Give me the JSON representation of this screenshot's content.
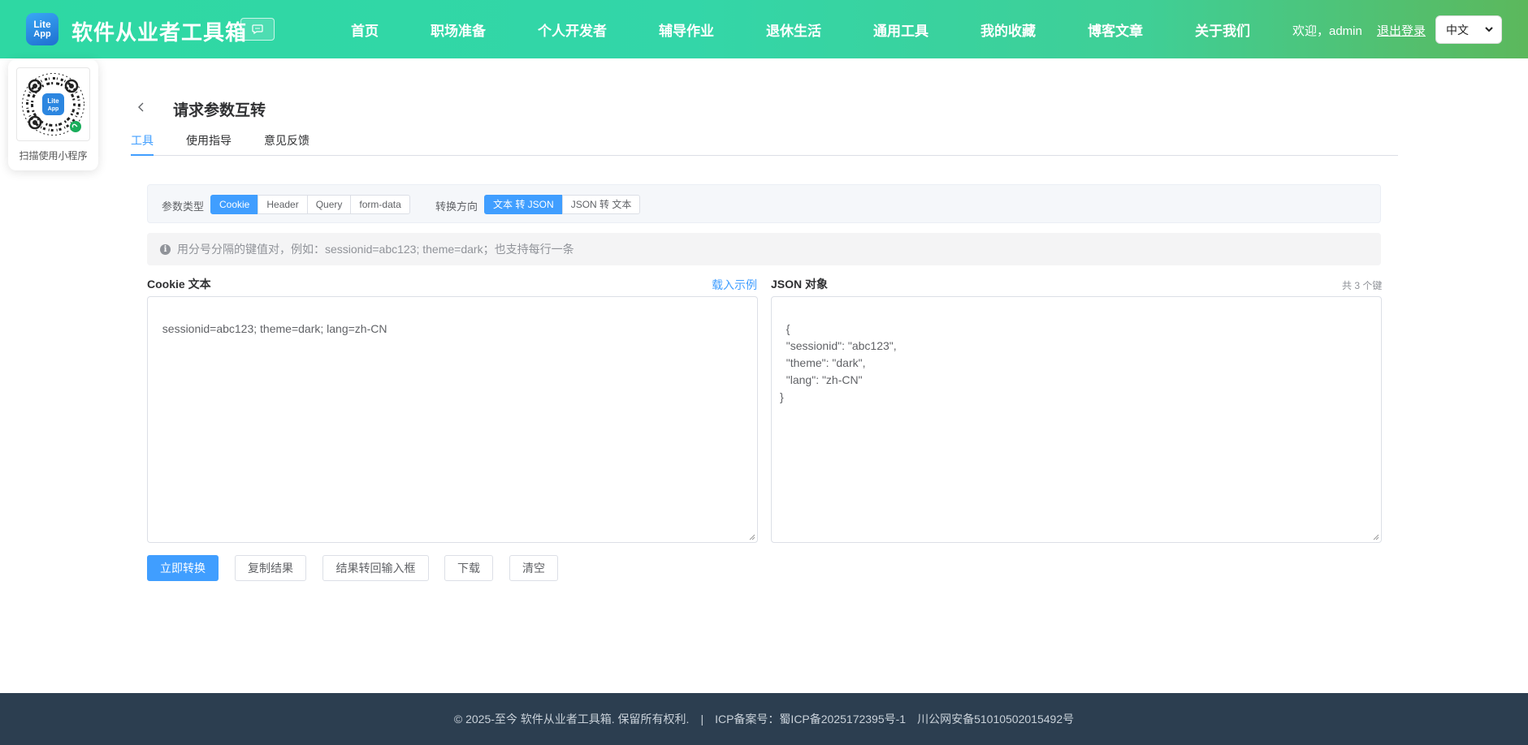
{
  "header": {
    "logo_line1": "Lite",
    "logo_line2": "App",
    "site_title": "软件从业者工具箱",
    "nav": [
      "首页",
      "职场准备",
      "个人开发者",
      "辅导作业",
      "退休生活",
      "通用工具",
      "我的收藏",
      "博客文章",
      "关于我们"
    ],
    "welcome": "欢迎，admin",
    "logout": "退出登录",
    "language": "中文"
  },
  "qr_card": {
    "label": "扫描使用小程序"
  },
  "page": {
    "title": "请求参数互转",
    "tabs": [
      "工具",
      "使用指导",
      "意见反馈"
    ],
    "active_tab": "工具"
  },
  "options": {
    "param_type_label": "参数类型",
    "param_types": [
      "Cookie",
      "Header",
      "Query",
      "form-data"
    ],
    "param_type_selected": "Cookie",
    "direction_label": "转换方向",
    "directions": [
      "文本 转 JSON",
      "JSON 转 文本"
    ],
    "direction_selected": "文本 转 JSON"
  },
  "hint": "用分号分隔的键值对，例如：sessionid=abc123; theme=dark；也支持每行一条",
  "input_pane": {
    "title": "Cookie 文本",
    "load_example": "载入示例",
    "value": "sessionid=abc123; theme=dark; lang=zh-CN"
  },
  "output_pane": {
    "title": "JSON 对象",
    "key_count": "共 3 个键",
    "value": "{\n  \"sessionid\": \"abc123\",\n  \"theme\": \"dark\",\n  \"lang\": \"zh-CN\"\n}"
  },
  "actions": {
    "convert": "立即转换",
    "copy": "复制结果",
    "to_input": "结果转回输入框",
    "download": "下载",
    "clear": "清空"
  },
  "footer": {
    "copyright": "© 2025-至今 软件从业者工具箱. 保留所有权利.",
    "separator": "|",
    "icp": "ICP备案号：蜀ICP备2025172395号-1",
    "police": "川公网安备51010502015492号"
  },
  "colors": {
    "header_gradient_start": "#2ed8a3",
    "header_gradient_end": "#5cb85c",
    "primary": "#409eff",
    "footer_bg": "#2c3e50"
  }
}
